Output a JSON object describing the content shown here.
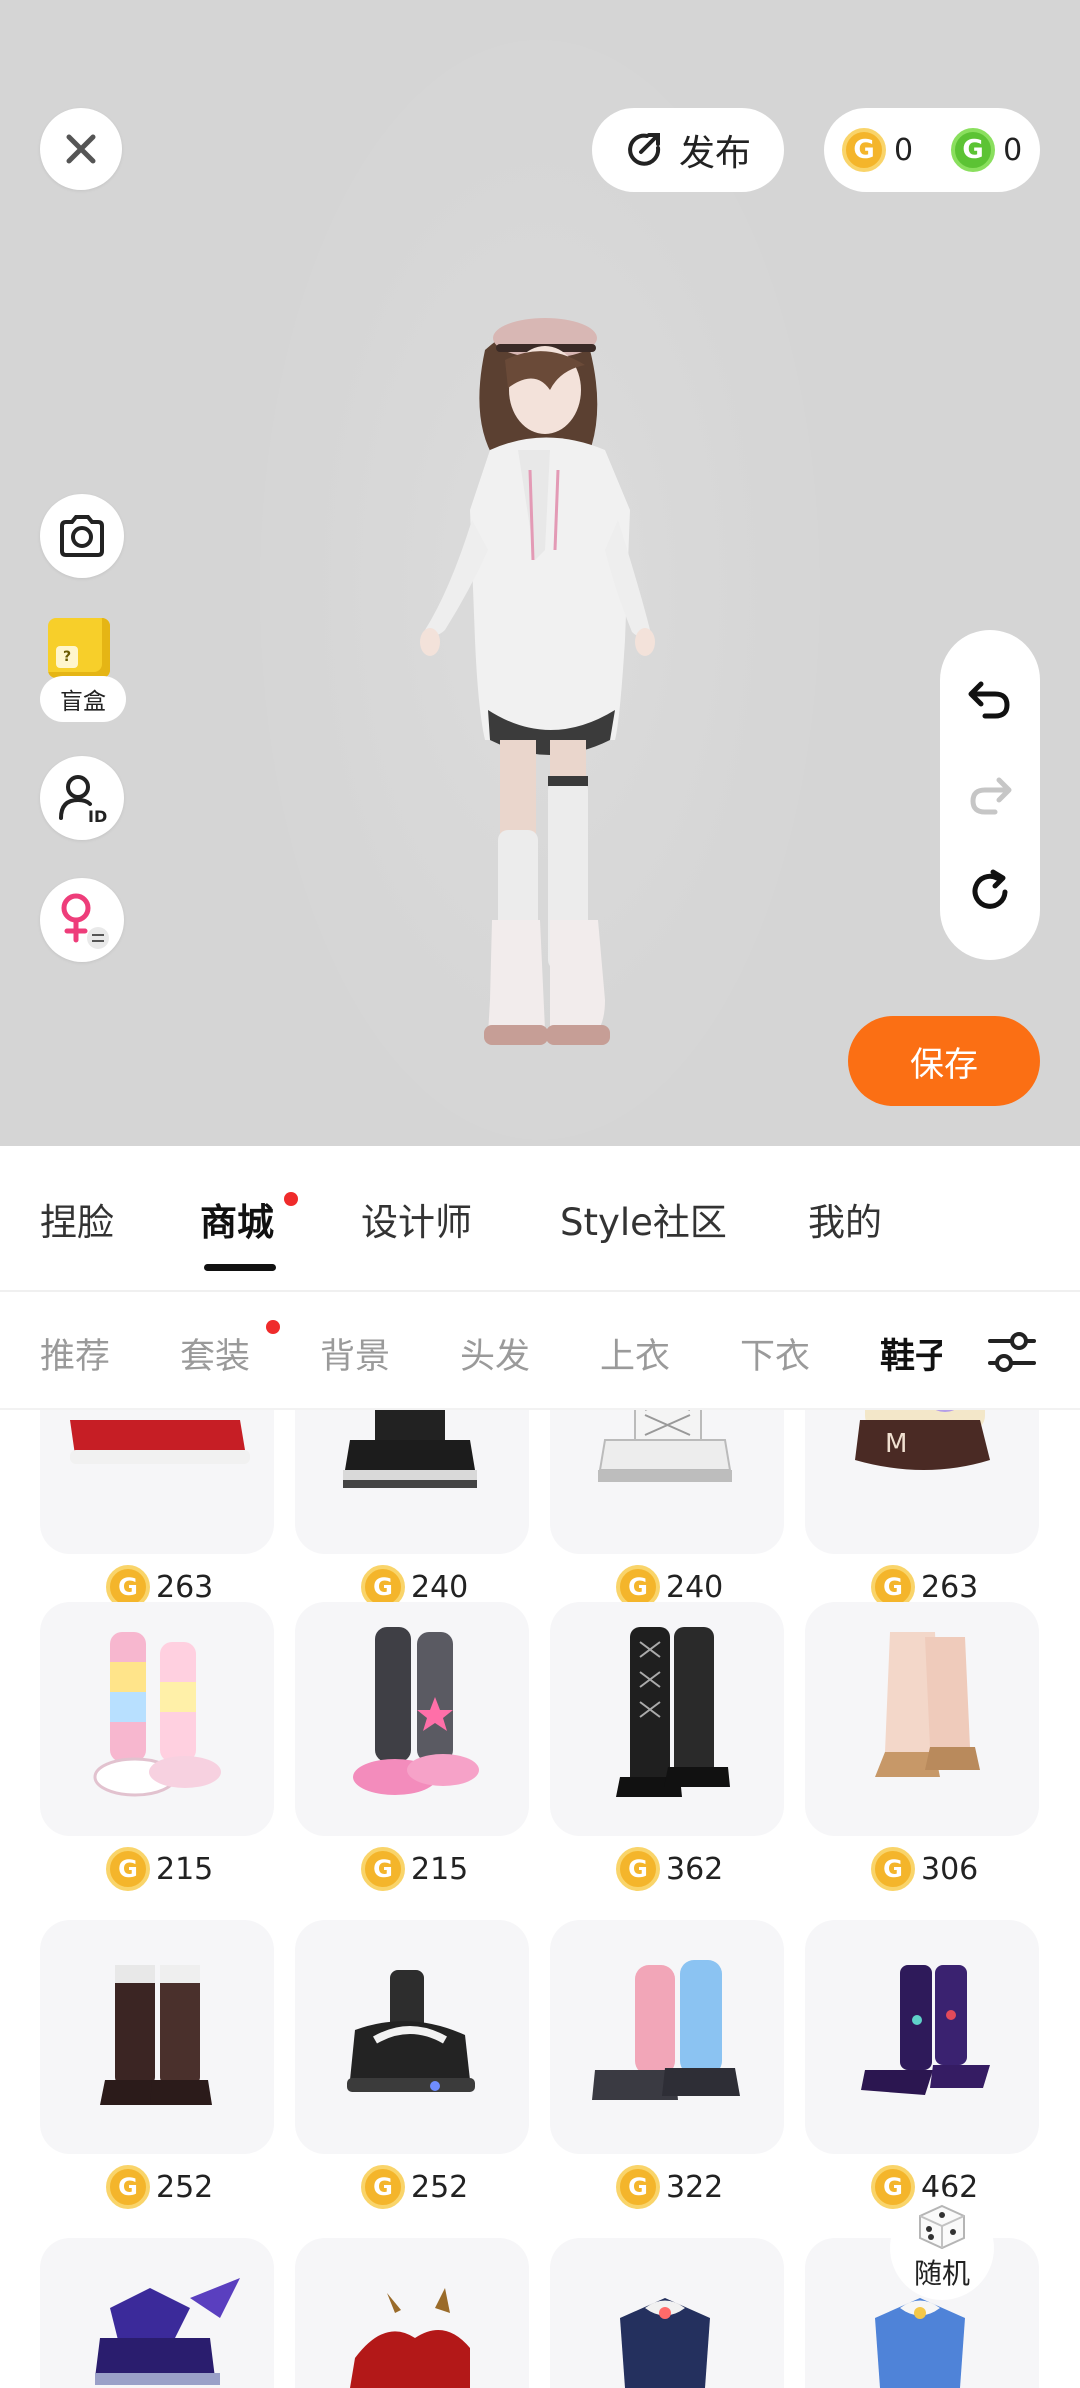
{
  "header": {
    "publish_label": "发布",
    "gold_coin_symbol": "G",
    "gold_balance": "0",
    "green_coin_symbol": "G",
    "green_balance": "0"
  },
  "side_tools": {
    "blind_box_label": "盲盒",
    "blind_box_mark": "?"
  },
  "actions": {
    "save_label": "保存"
  },
  "main_tabs": [
    {
      "label": "捏脸"
    },
    {
      "label": "商城"
    },
    {
      "label": "设计师"
    },
    {
      "label": "Style社区"
    },
    {
      "label": "我的"
    }
  ],
  "sub_tabs": [
    {
      "label": "推荐"
    },
    {
      "label": "套装"
    },
    {
      "label": "背景"
    },
    {
      "label": "头发"
    },
    {
      "label": "上衣"
    },
    {
      "label": "下衣"
    },
    {
      "label": "鞋子"
    }
  ],
  "items": [
    {
      "price": "263",
      "icon": "red-shoe"
    },
    {
      "price": "240",
      "icon": "black-platform-boot"
    },
    {
      "price": "240",
      "icon": "white-lace-boot"
    },
    {
      "price": "263",
      "icon": "brown-sneaker"
    },
    {
      "price": "215",
      "icon": "rainbow-leg-warmer-boot"
    },
    {
      "price": "215",
      "icon": "pink-star-boot"
    },
    {
      "price": "362",
      "icon": "black-knee-lace-boot"
    },
    {
      "price": "306",
      "icon": "beige-fur-boot"
    },
    {
      "price": "252",
      "icon": "brown-chunky-boot"
    },
    {
      "price": "252",
      "icon": "black-strap-sandal"
    },
    {
      "price": "322",
      "icon": "pink-blue-sock-shoe"
    },
    {
      "price": "462",
      "icon": "purple-heel-boot"
    },
    {
      "price": "",
      "icon": "purple-wing-shoe"
    },
    {
      "price": "",
      "icon": "red-devil-shoe"
    },
    {
      "price": "",
      "icon": "navy-ribbon-shoe"
    },
    {
      "price": "",
      "icon": "blue-ribbon-shoe"
    }
  ],
  "random": {
    "label": "随机"
  },
  "colors": {
    "accent": "#fb6f14",
    "stage_bg": "#d5d5d5",
    "gold_coin": "#f4b52b",
    "green_coin": "#5cc334",
    "badge_red": "#ef2b2b"
  }
}
